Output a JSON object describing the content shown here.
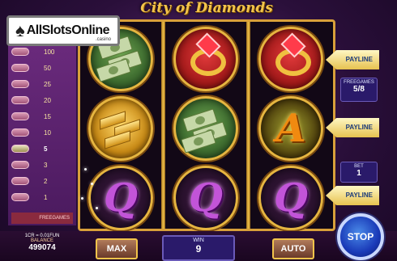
{
  "logo": {
    "text": "AllSlotsOnline",
    "sub": ".casino"
  },
  "title": "City of Diamonds",
  "paytable": {
    "rows": [
      "100",
      "50",
      "25",
      "20",
      "15",
      "10",
      "5",
      "3",
      "2",
      "1"
    ],
    "active_index": 6,
    "footer": "FREEGAMES"
  },
  "reels": [
    [
      "money",
      "gold",
      "Q"
    ],
    [
      "ring",
      "money",
      "Q"
    ],
    [
      "ring",
      "A",
      "Q"
    ]
  ],
  "symbol_letters": {
    "A": "A",
    "Q": "Q"
  },
  "paylines": {
    "label": "PAYLINE"
  },
  "freegames": {
    "label": "FREEGAMES",
    "value": "5/8"
  },
  "bet": {
    "label": "BET",
    "value": "1"
  },
  "balance": {
    "coin": "1CR = 0.01FUN",
    "label": "BALANCE",
    "value": "499074"
  },
  "buttons": {
    "max": "MAX",
    "auto": "AUTO",
    "stop": "STOP"
  },
  "win": {
    "label": "WIN",
    "value": "9"
  },
  "colors": {
    "gold": "#f2c44b",
    "purple": "#5a2a6e",
    "stop_blue": "#1a3ab8"
  }
}
